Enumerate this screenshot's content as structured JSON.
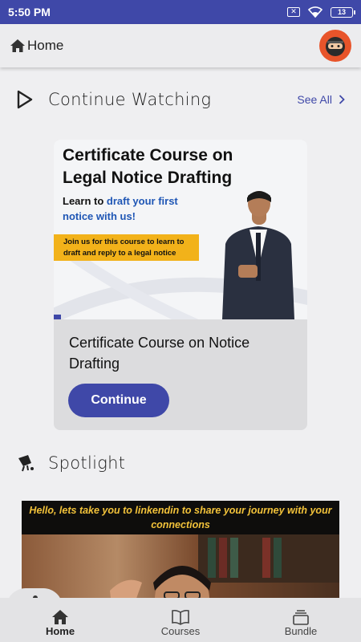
{
  "status_bar": {
    "time": "5:50 PM",
    "battery": "13"
  },
  "app_bar": {
    "title": "Home"
  },
  "continue_watching": {
    "heading": "Continue Watching",
    "see_all": "See All",
    "card": {
      "thumb_title": "Certificate Course on Legal Notice Drafting",
      "thumb_line_a": "Learn to ",
      "thumb_line_hl": "draft your first notice with us!",
      "thumb_banner": "Join us for this course to learn to draft and reply to a legal notice",
      "progress_fraction": 0.03,
      "title": "Certificate Course on Notice Drafting",
      "button": "Continue"
    }
  },
  "spotlight": {
    "heading": "Spotlight",
    "banner_caption": "Hello, lets take you to linkendin to share your journey with your connections"
  },
  "bottom_nav": [
    {
      "label": "Home",
      "icon": "home-icon"
    },
    {
      "label": "Courses",
      "icon": "book-icon"
    },
    {
      "label": "Bundle",
      "icon": "bundle-icon"
    }
  ],
  "colors": {
    "primary": "#3f48a8",
    "highlight": "#1f56b5",
    "banner_yellow": "#f2b21a"
  }
}
